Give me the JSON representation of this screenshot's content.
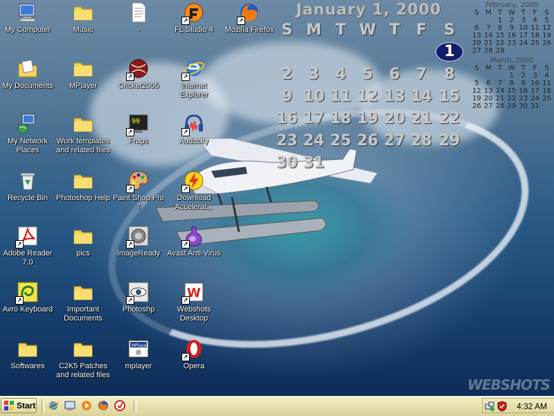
{
  "desktop_icons": [
    {
      "label": "My Computer"
    },
    {
      "label": "My Documents"
    },
    {
      "label": "My Network Places"
    },
    {
      "label": "Recycle Bin"
    },
    {
      "label": "Adobe Reader 7.0"
    },
    {
      "label": "Avro Keyboard"
    },
    {
      "label": "Softwares"
    },
    {
      "label": "Music"
    },
    {
      "label": "MPlayer"
    },
    {
      "label": "Work templates and related files"
    },
    {
      "label": "Photoshop Help"
    },
    {
      "label": "pics"
    },
    {
      "label": "Important Documents"
    },
    {
      "label": "C2K5 Patches and related files"
    },
    {
      "label": "-"
    },
    {
      "label": "Cricket2005"
    },
    {
      "label": "Fraps"
    },
    {
      "label": "Paint Shop Pro 7"
    },
    {
      "label": "ImageReady"
    },
    {
      "label": "Photoshp"
    },
    {
      "label": "mplayer"
    },
    {
      "label": "FL Studio 4"
    },
    {
      "label": "Internet Explorer"
    },
    {
      "label": "Audacity"
    },
    {
      "label": "Download Accelerat..."
    },
    {
      "label": "Avast Anti-Virus"
    },
    {
      "label": "Webshots Desktop"
    },
    {
      "label": "Opera"
    },
    {
      "label": "Mozilla Firefox"
    }
  ],
  "calendar_main": {
    "title": "January 1, 2000",
    "weekdays": [
      "S",
      "M",
      "T",
      "W",
      "T",
      "F",
      "S"
    ],
    "weeks": [
      [
        "",
        "",
        "",
        "",
        "",
        "",
        "1"
      ],
      [
        "2",
        "3",
        "4",
        "5",
        "6",
        "7",
        "8"
      ],
      [
        "9",
        "10",
        "11",
        "12",
        "13",
        "14",
        "15"
      ],
      [
        "16",
        "17",
        "18",
        "19",
        "20",
        "21",
        "22"
      ],
      [
        "23",
        "24",
        "25",
        "26",
        "27",
        "28",
        "29"
      ],
      [
        "30",
        "31",
        "",
        "",
        "",
        "",
        ""
      ]
    ],
    "today": "1"
  },
  "calendar_feb": {
    "title": "February, 2000",
    "weekdays": [
      "S",
      "M",
      "T",
      "W",
      "T",
      "F",
      "S"
    ],
    "weeks": [
      [
        "",
        "",
        "1",
        "2",
        "3",
        "4",
        "5"
      ],
      [
        "6",
        "7",
        "8",
        "9",
        "10",
        "11",
        "12"
      ],
      [
        "13",
        "14",
        "15",
        "16",
        "17",
        "18",
        "19"
      ],
      [
        "20",
        "21",
        "22",
        "23",
        "24",
        "25",
        "26"
      ],
      [
        "27",
        "28",
        "29",
        "",
        "",
        "",
        ""
      ]
    ]
  },
  "calendar_mar": {
    "title": "March, 2000",
    "weekdays": [
      "S",
      "M",
      "T",
      "W",
      "T",
      "F",
      "S"
    ],
    "weeks": [
      [
        "",
        "",
        "",
        "1",
        "2",
        "3",
        "4"
      ],
      [
        "5",
        "6",
        "7",
        "8",
        "9",
        "10",
        "11"
      ],
      [
        "12",
        "13",
        "14",
        "15",
        "16",
        "17",
        "18"
      ],
      [
        "19",
        "20",
        "21",
        "22",
        "23",
        "24",
        "25"
      ],
      [
        "26",
        "27",
        "28",
        "29",
        "30",
        "31",
        ""
      ]
    ]
  },
  "watermark": "WEBSHOTS",
  "taskbar": {
    "start_label": "Start",
    "clock": "4:32 AM",
    "quick_launch": [
      "internet-explorer-icon",
      "desktop-icon",
      "media-player-icon",
      "firefox-icon",
      "antivirus-icon"
    ]
  },
  "colors": {
    "taskbar": "#e7e2b1",
    "today_highlight": "#0f1e6a"
  }
}
